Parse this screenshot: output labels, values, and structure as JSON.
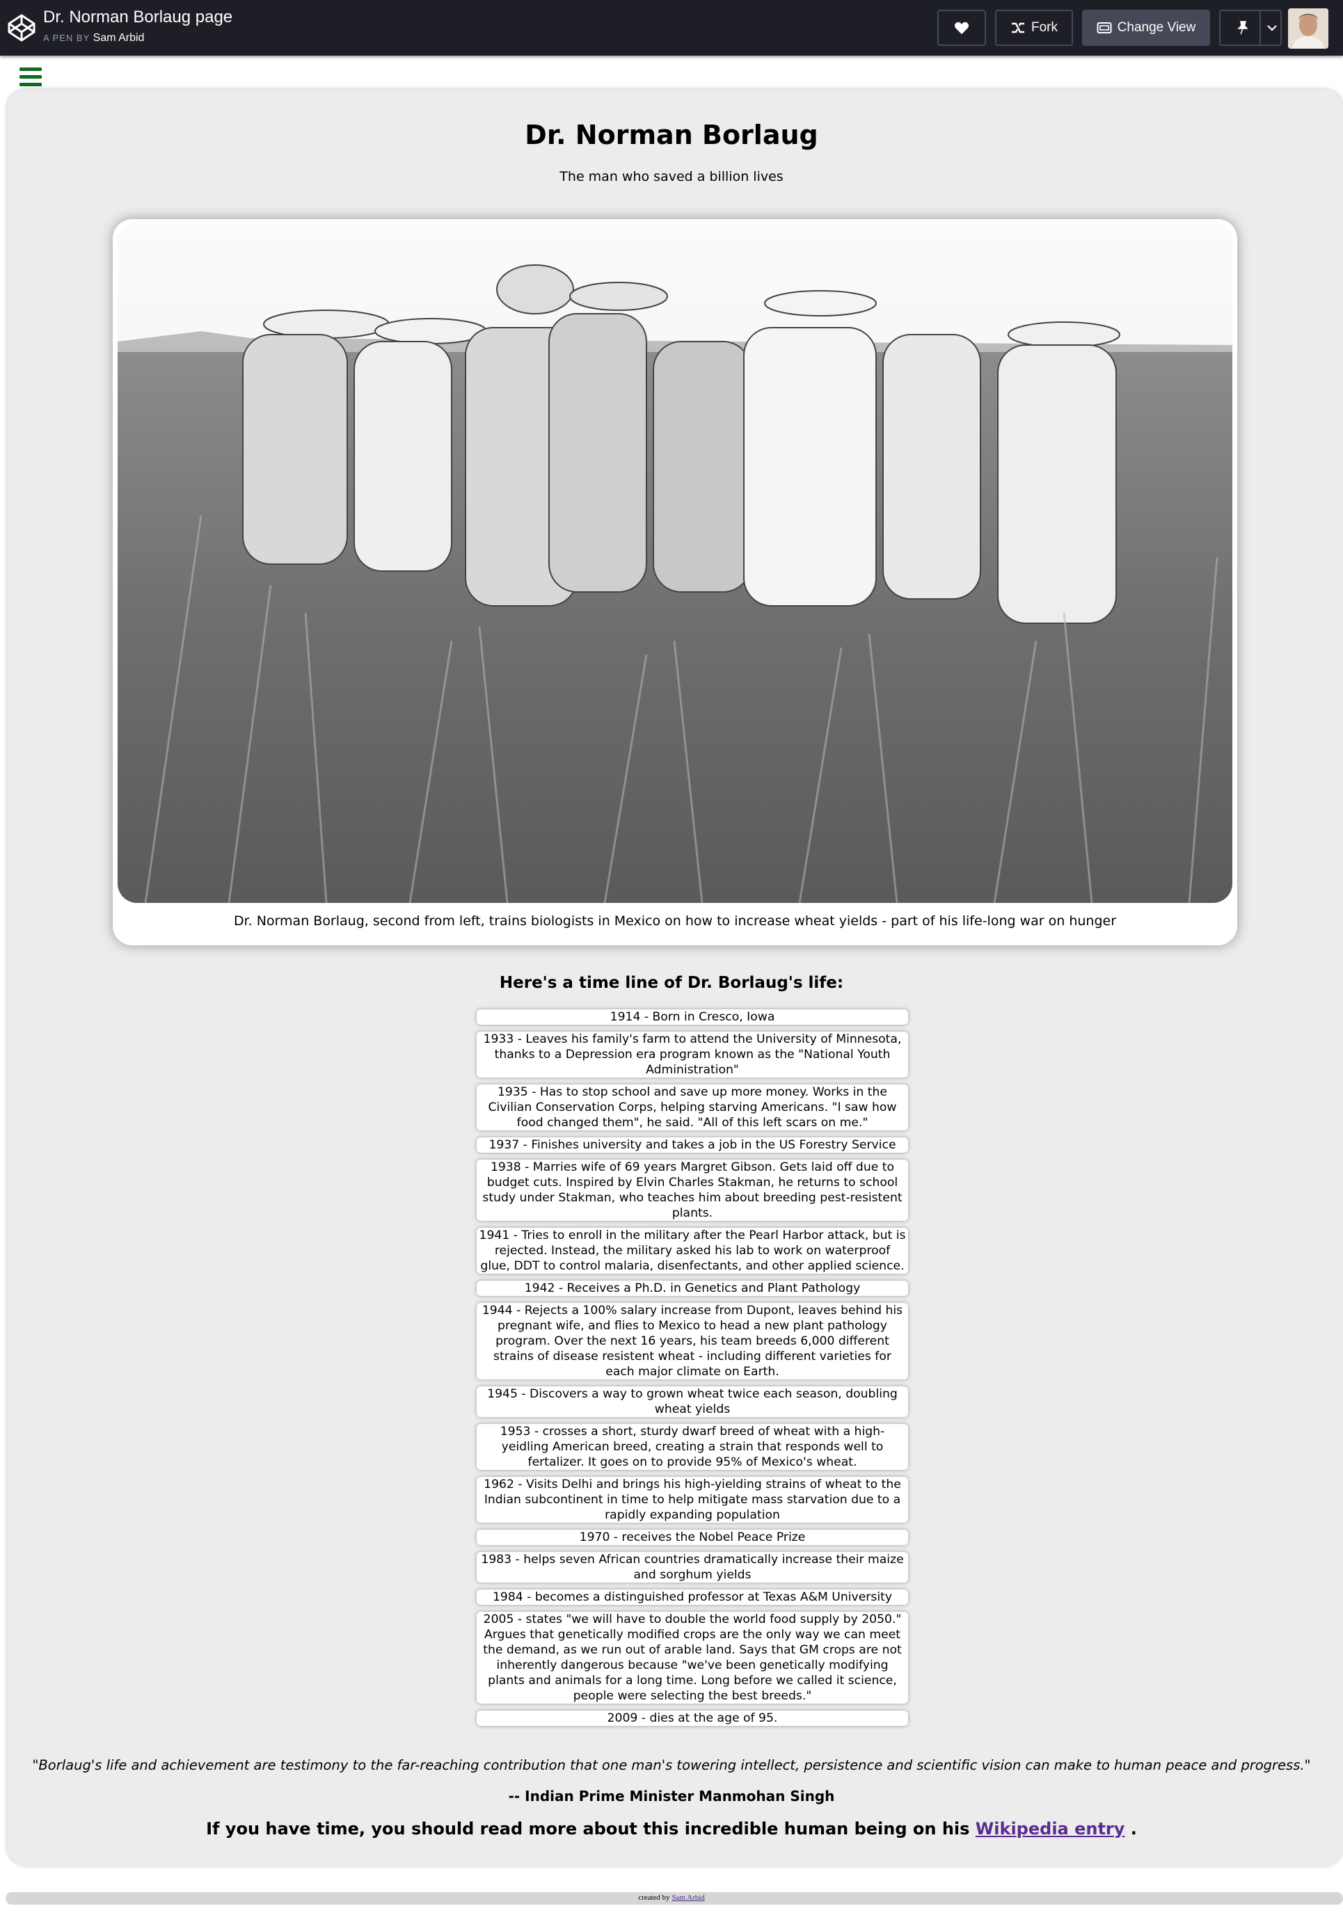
{
  "header": {
    "pen_title": "Dr. Norman Borlaug page",
    "byline_prefix": "A PEN BY",
    "author": "Sam Arbid",
    "fork_label": "Fork",
    "change_view_label": "Change View",
    "colors": {
      "bar": "#1e1f26",
      "button": "#2c303a",
      "button_border": "#444857"
    }
  },
  "page": {
    "title": "Dr. Norman Borlaug",
    "subtitle": "The man who saved a billion lives",
    "caption": "Dr. Norman Borlaug, second from left, trains biologists in Mexico on how to increase wheat yields - part of his life-long war on hunger",
    "timeline_heading": "Here's a time line of Dr. Borlaug's life:",
    "timeline": [
      "1914 - Born in Cresco, Iowa",
      "1933 - Leaves his family's farm to attend the University of Minnesota, thanks to a Depression era program known as the \"National Youth Administration\"",
      "1935 - Has to stop school and save up more money. Works in the Civilian Conservation Corps, helping starving Americans. \"I saw how food changed them\", he said. \"All of this left scars on me.\"",
      "1937 - Finishes university and takes a job in the US Forestry Service",
      "1938 - Marries wife of 69 years Margret Gibson. Gets laid off due to budget cuts. Inspired by Elvin Charles Stakman, he returns to school study under Stakman, who teaches him about breeding pest-resistent plants.",
      "1941 - Tries to enroll in the military after the Pearl Harbor attack, but is rejected. Instead, the military asked his lab to work on waterproof glue, DDT to control malaria, disenfectants, and other applied science.",
      "1942 - Receives a Ph.D. in Genetics and Plant Pathology",
      "1944 - Rejects a 100% salary increase from Dupont, leaves behind his pregnant wife, and flies to Mexico to head a new plant pathology program. Over the next 16 years, his team breeds 6,000 different strains of disease resistent wheat - including different varieties for each major climate on Earth.",
      "1945 - Discovers a way to grown wheat twice each season, doubling wheat yields",
      "1953 - crosses a short, sturdy dwarf breed of wheat with a high-yeidling American breed, creating a strain that responds well to fertalizer. It goes on to provide 95% of Mexico's wheat.",
      "1962 - Visits Delhi and brings his high-yielding strains of wheat to the Indian subcontinent in time to help mitigate mass starvation due to a rapidly expanding population",
      "1970 - receives the Nobel Peace Prize",
      "1983 - helps seven African countries dramatically increase their maize and sorghum yields",
      "1984 - becomes a distinguished professor at Texas A&M University",
      "2005 - states \"we will have to double the world food supply by 2050.\" Argues that genetically modified crops are the only way we can meet the demand, as we run out of arable land. Says that GM crops are not inherently dangerous because \"we've been genetically modifying plants and animals for a long time. Long before we called it science, people were selecting the best breeds.\"",
      "2009 - dies at the age of 95."
    ],
    "quote": "\"Borlaug's life and achievement are testimony to the far-reaching contribution that one man's towering intellect, persistence and scientific vision can make to human peace and progress.\"",
    "quote_author": "-- Indian Prime Minister Manmohan Singh",
    "more_prefix": "If you have time, you should read more about this incredible human being on his",
    "more_link": "Wikipedia entry",
    "more_suffix": ".",
    "colors": {
      "card": "#ececec",
      "hamburger": "#0f6b1d",
      "link": "#5a2c8f"
    }
  },
  "footer": {
    "credit_prefix": "created by",
    "credit_author": "Sam Arbid"
  }
}
